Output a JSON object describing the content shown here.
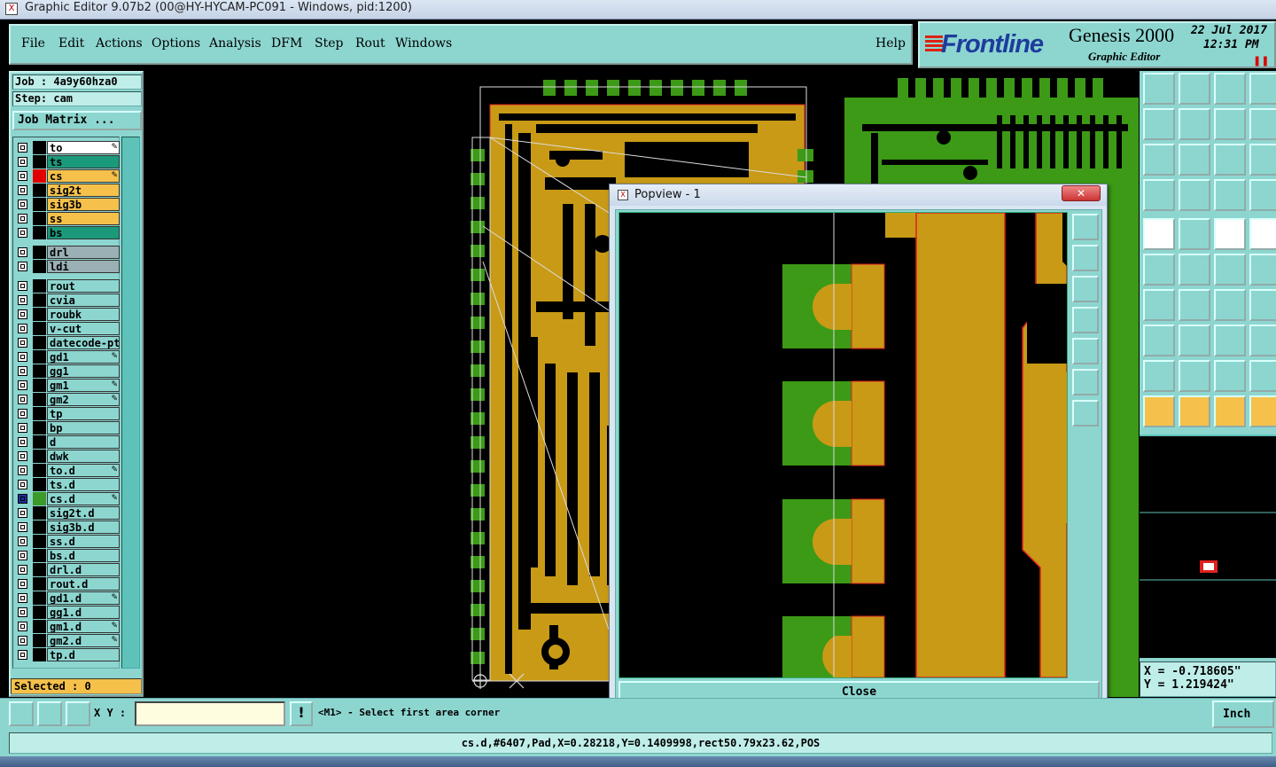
{
  "window": {
    "title": "Graphic Editor 9.07b2 (00@HY-HYCAM-PC091 - Windows, pid:1200)"
  },
  "menu": {
    "items": [
      "File",
      "Edit",
      "Actions",
      "Options",
      "Analysis",
      "DFM",
      "Step",
      "Rout",
      "Windows"
    ],
    "help": "Help"
  },
  "brand": {
    "logo": "Frontline",
    "product": "Genesis 2000",
    "subtitle": "Graphic Editor",
    "date": "22 Jul 2017",
    "time": "12:31 PM"
  },
  "job": {
    "job_label": "Job : 4a9y60hza0",
    "step_label": "Step: cam",
    "matrix_button": "Job Matrix ..."
  },
  "layers": [
    {
      "name": "to",
      "color": "#ffffff",
      "edit": true
    },
    {
      "name": "ts",
      "color": "#1a9a7a",
      "edit": false
    },
    {
      "name": "cs",
      "color": "#f5c14b",
      "edit": true,
      "marked": "#e00000"
    },
    {
      "name": "sig2t",
      "color": "#f5c14b",
      "edit": false
    },
    {
      "name": "sig3b",
      "color": "#f5c14b",
      "edit": false
    },
    {
      "name": "ss",
      "color": "#f5c14b",
      "edit": false
    },
    {
      "name": "bs",
      "color": "#1a9a7a",
      "edit": false
    },
    {
      "name": "drl",
      "color": "#9ab0b4",
      "edit": false
    },
    {
      "name": "ldi",
      "color": "#9ab0b4",
      "edit": false
    },
    {
      "name": "rout",
      "color": "#8dd6d0",
      "edit": false
    },
    {
      "name": "cvia",
      "color": "#8dd6d0",
      "edit": false
    },
    {
      "name": "roubk",
      "color": "#8dd6d0",
      "edit": false
    },
    {
      "name": "v-cut",
      "color": "#8dd6d0",
      "edit": false
    },
    {
      "name": "datecode-pt",
      "color": "#8dd6d0",
      "edit": false
    },
    {
      "name": "gd1",
      "color": "#8dd6d0",
      "edit": true
    },
    {
      "name": "gg1",
      "color": "#8dd6d0",
      "edit": false
    },
    {
      "name": "gm1",
      "color": "#8dd6d0",
      "edit": true
    },
    {
      "name": "gm2",
      "color": "#8dd6d0",
      "edit": true
    },
    {
      "name": "tp",
      "color": "#8dd6d0",
      "edit": false
    },
    {
      "name": "bp",
      "color": "#8dd6d0",
      "edit": false
    },
    {
      "name": "d",
      "color": "#8dd6d0",
      "edit": false
    },
    {
      "name": "dwk",
      "color": "#8dd6d0",
      "edit": false
    },
    {
      "name": "to.d",
      "color": "#8dd6d0",
      "edit": true
    },
    {
      "name": "ts.d",
      "color": "#8dd6d0",
      "edit": false
    },
    {
      "name": "cs.d",
      "color": "#8dd6d0",
      "edit": true,
      "marked": "#3a9a2a",
      "active": true
    },
    {
      "name": "sig2t.d",
      "color": "#8dd6d0",
      "edit": false
    },
    {
      "name": "sig3b.d",
      "color": "#8dd6d0",
      "edit": false
    },
    {
      "name": "ss.d",
      "color": "#8dd6d0",
      "edit": false
    },
    {
      "name": "bs.d",
      "color": "#8dd6d0",
      "edit": false
    },
    {
      "name": "drl.d",
      "color": "#8dd6d0",
      "edit": false
    },
    {
      "name": "rout.d",
      "color": "#8dd6d0",
      "edit": false
    },
    {
      "name": "gd1.d",
      "color": "#8dd6d0",
      "edit": true
    },
    {
      "name": "gg1.d",
      "color": "#8dd6d0",
      "edit": false
    },
    {
      "name": "gm1.d",
      "color": "#8dd6d0",
      "edit": true
    },
    {
      "name": "gm2.d",
      "color": "#8dd6d0",
      "edit": true
    },
    {
      "name": "tp.d",
      "color": "#8dd6d0",
      "edit": false
    }
  ],
  "selected": "Selected : 0",
  "popview": {
    "title": "Popview - 1",
    "close_label": "Close"
  },
  "coords": {
    "x": "X = -0.718605\"",
    "y": "Y = 1.219424\""
  },
  "input": {
    "xy_label": "X Y :",
    "prompt": "<M1> - Select first area corner"
  },
  "units": "Inch",
  "status": "cs.d,#6407,Pad,X=0.28218,Y=0.1409998,rect50.79x23.62,POS",
  "colors": {
    "panel": "#8dd6d0",
    "copper": "#c89a16",
    "green": "#3c9a16",
    "outline": "#e02020"
  }
}
